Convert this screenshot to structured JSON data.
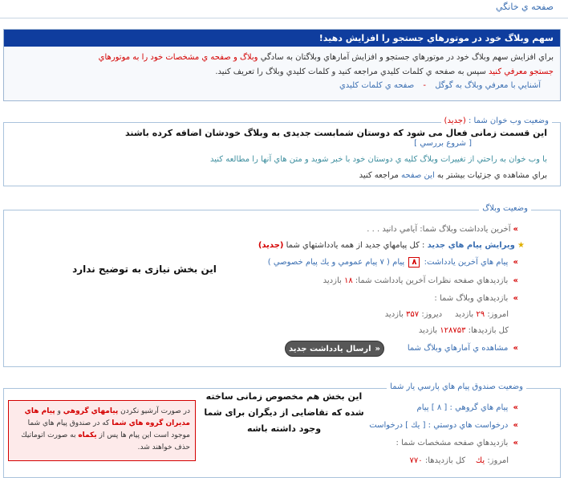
{
  "page_title": "صفحه ي خانگي",
  "promo": {
    "headline": "سهم وبلاگ خود در موتورهاي جستجو را افزايش دهيد!",
    "line1_a": "براي افزايش سهم وبلاگ خود در موتورهاي جستجو و افزايش آمارهاي وبلاگتان به سادگي",
    "line1_red": "وبلاگ و صفحه ي مشخصات خود را به موتورهاي",
    "line2_red": "جستجو معرفي كنيد",
    "line2_a": "سپس به صفحه ي كلمات كليدي مراجعه كنيد و كلمات كليدي وبلاگ را تعريف كنيد.",
    "link_google": "آشنايي با معرفي وبلاگ به گوگل",
    "link_sep": "-",
    "link_keywords": "صفحه ي كلمات كليدي"
  },
  "friends": {
    "legend": "وضعيت وب خوان شما :",
    "legend_new": "(جديد)",
    "annotation": "این قسمت زمانی فعال می شود که دوستان شمابست جدیدی به وبلاگ خودشان اضافه کرده باشند",
    "start_check": "[ شروع بررسي ]",
    "desc1": "با وب خوان به راحتي از تغييرات وبلاگ كليه ي دوستان خود با خبر شويد و متن هاي آنها را مطالعه كنيد",
    "desc2_a": "براي مشاهده ي جزئيات بيشتر به",
    "desc2_link": "اين صفحه",
    "desc2_b": "مراجعه كنيد"
  },
  "blog": {
    "legend": "وضعيت وبلاگ",
    "last_post": "آخرين يادداشت وبلاگ شما: آيامي دانيد . . .",
    "edit_msgs_bold": "ويرايش پيام هاي جديد",
    "edit_msgs_rest": ": كل پيامهاي جديد از همه يادداشتهاي شما",
    "edit_msgs_new": "(جديد)",
    "last_comments_label": "پيام هاي آخرين يادداشت:",
    "last_comments_count": "۸",
    "last_comments_unit": "پيام",
    "last_comments_detail": "( ۷ پيام عمومي و يك پيام خصوصي )",
    "comments_visits_label": "بازديدهاي صفحه نظرات آخرين يادداشت شما:",
    "comments_visits_value": "۱۸",
    "comments_visits_unit": "بازديد",
    "blog_visits_label": "بازديدهاي وبلاگ شما :",
    "today_label": "امروز:",
    "today_value": "۲۹",
    "today_unit": "بازديد",
    "yesterday_label": "ديروز:",
    "yesterday_value": "۳۵۷",
    "yesterday_unit": "بازديد",
    "total_label": "كل بازديدها:",
    "total_value": "۱۲۸۷۵۳",
    "total_unit": "بازديد",
    "stats_link": "مشاهده ي آمارهاي وبلاگ شما",
    "send_post_button": "ارسال يادداشت جديد",
    "annotation": "این بخش نیازی به توضیح ندارد"
  },
  "inbox": {
    "legend": "وضعيت صندوق پيام هاي پارسي يار شما",
    "group_msgs_label": "پيام هاي گروهي :",
    "group_msgs_value": "[ ۸ ]",
    "group_msgs_unit": "پيام",
    "friend_requests_label": "درخواست هاي دوستي :",
    "friend_requests_value": "[ يك ]",
    "friend_requests_unit": "درخواست",
    "profile_visits_label": "بازديدهاي صفحه مشخصات شما :",
    "today_partial": "امروز:",
    "today_partial_value": "يك",
    "total_partial": "كل بازديدها:",
    "total_partial_value": "۷۷۰",
    "annotation": "این بخش هم مخصوص زمانی ساخته شده که تقاضایی از دیگران برای شما وجود داشته باشه",
    "note_a": "در صورت آرشيو نكردن",
    "note_red1": "پيامهاي گروهي",
    "note_b": "و",
    "note_red2": "پيام هاي مديران گروه هاي شما",
    "note_c": "كه در صندوق پيام هاي شما موجود است اين پيام ها پس از",
    "note_red3": "يكماه",
    "note_d": "به صورت اتوماتيك حذف خواهند شد."
  }
}
